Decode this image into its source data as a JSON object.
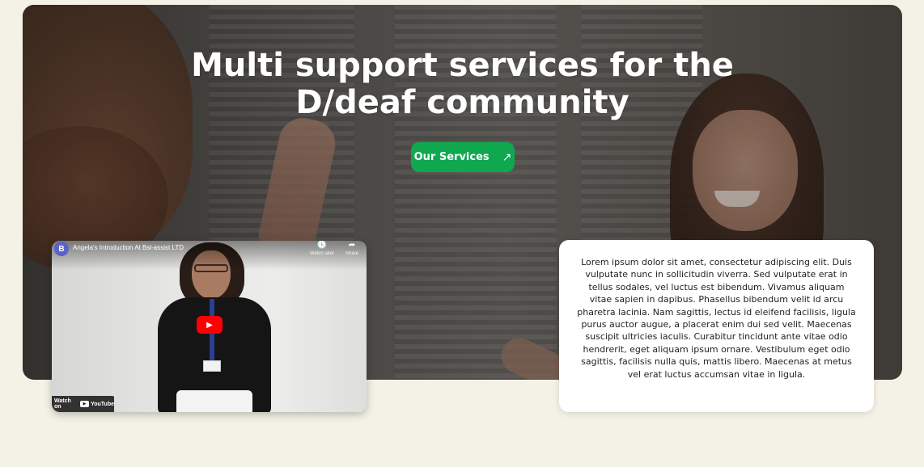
{
  "hero": {
    "title": "Multi support services for the D/deaf community",
    "button_label": "Our Services",
    "button_icon": "arrow-up-right-icon"
  },
  "video": {
    "channel_initial": "B",
    "title": "Angela's Introduction At Bsl-assist LTD",
    "watch_later_label": "Watch later",
    "share_label": "Share",
    "watch_on_label": "Watch on",
    "youtube_label": "YouTube"
  },
  "info_card": {
    "text": "Lorem ipsum dolor sit amet, consectetur adipiscing elit. Duis vulputate nunc in sollicitudin viverra. Sed vulputate erat in tellus sodales, vel luctus est bibendum. Vivamus aliquam vitae sapien in dapibus. Phasellus bibendum velit id arcu pharetra lacinia. Nam sagittis, lectus id eleifend facilisis, ligula purus auctor augue, a placerat enim dui sed velit. Maecenas suscipit ultricies iaculis. Curabitur tincidunt ante vitae odio hendrerit, eget aliquam ipsum ornare. Vestibulum eget odio sagittis, facilisis nulla quis, mattis libero. Maecenas at metus vel erat luctus accumsan vitae in ligula."
  },
  "colors": {
    "page_background": "#f4f1e6",
    "button_green": "#0fa84f",
    "youtube_red": "#ff0000"
  }
}
